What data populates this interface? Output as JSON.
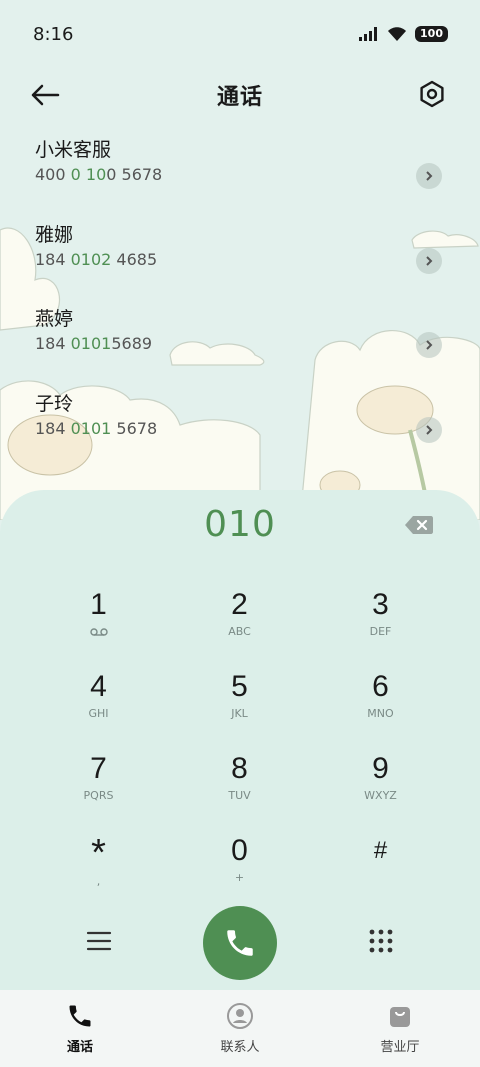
{
  "status_bar": {
    "time": "8:16",
    "battery": "100"
  },
  "header": {
    "title": "通话"
  },
  "suggestions": [
    {
      "name": "小米客服",
      "num_pre": "400 ",
      "num_hl": "0 10",
      "num_post": "0 5678"
    },
    {
      "name": "雅娜",
      "num_pre": "184 ",
      "num_hl": "0102",
      "num_post": " 4685"
    },
    {
      "name": "燕婷",
      "num_pre": "184 ",
      "num_hl": "0101",
      "num_post": "5689"
    },
    {
      "name": "子玲",
      "num_pre": "184 ",
      "num_hl": "0101",
      "num_post": " 5678"
    }
  ],
  "dialer": {
    "input": "010",
    "keys": [
      [
        {
          "d": "1",
          "s": "voicemail"
        },
        {
          "d": "2",
          "s": "ABC"
        },
        {
          "d": "3",
          "s": "DEF"
        }
      ],
      [
        {
          "d": "4",
          "s": "GHI"
        },
        {
          "d": "5",
          "s": "JKL"
        },
        {
          "d": "6",
          "s": "MNO"
        }
      ],
      [
        {
          "d": "7",
          "s": "PQRS"
        },
        {
          "d": "8",
          "s": "TUV"
        },
        {
          "d": "9",
          "s": "WXYZ"
        }
      ],
      [
        {
          "d": "*",
          "s": ","
        },
        {
          "d": "0",
          "s": "+"
        },
        {
          "d": "#",
          "s": ""
        }
      ]
    ]
  },
  "nav": [
    {
      "label": "通话",
      "icon": "phone-icon",
      "active": true
    },
    {
      "label": "联系人",
      "icon": "contacts-icon",
      "active": false
    },
    {
      "label": "营业厅",
      "icon": "shopping-bag-icon",
      "active": false
    }
  ],
  "colors": {
    "accent": "#4f8f53",
    "background": "#e3f1ed",
    "dialer_bg": "#dcefe9"
  }
}
